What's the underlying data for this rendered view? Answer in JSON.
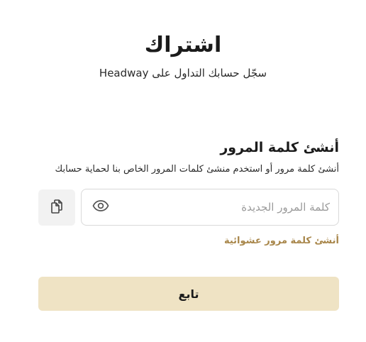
{
  "header": {
    "title": "اشتراك",
    "subtitle": "سجّل حسابك التداول على Headway"
  },
  "password_section": {
    "title": "أنشئ كلمة المرور",
    "description": "أنشئ كلمة مرور أو استخدم منشئ كلمات المرور الخاص بنا لحماية حسابك",
    "input_value": "",
    "input_placeholder": "كلمة المرور الجديدة",
    "copy_icon": "copy-icon",
    "visibility_icon": "eye-icon",
    "generate_link": "أنشئ كلمة مرور عشوائية"
  },
  "actions": {
    "continue_label": "تابع"
  },
  "colors": {
    "accent_link": "#a8864a",
    "continue_bg": "#efe3c4",
    "copy_bg": "#f2f2f2",
    "field_border": "#d9d9d9"
  }
}
